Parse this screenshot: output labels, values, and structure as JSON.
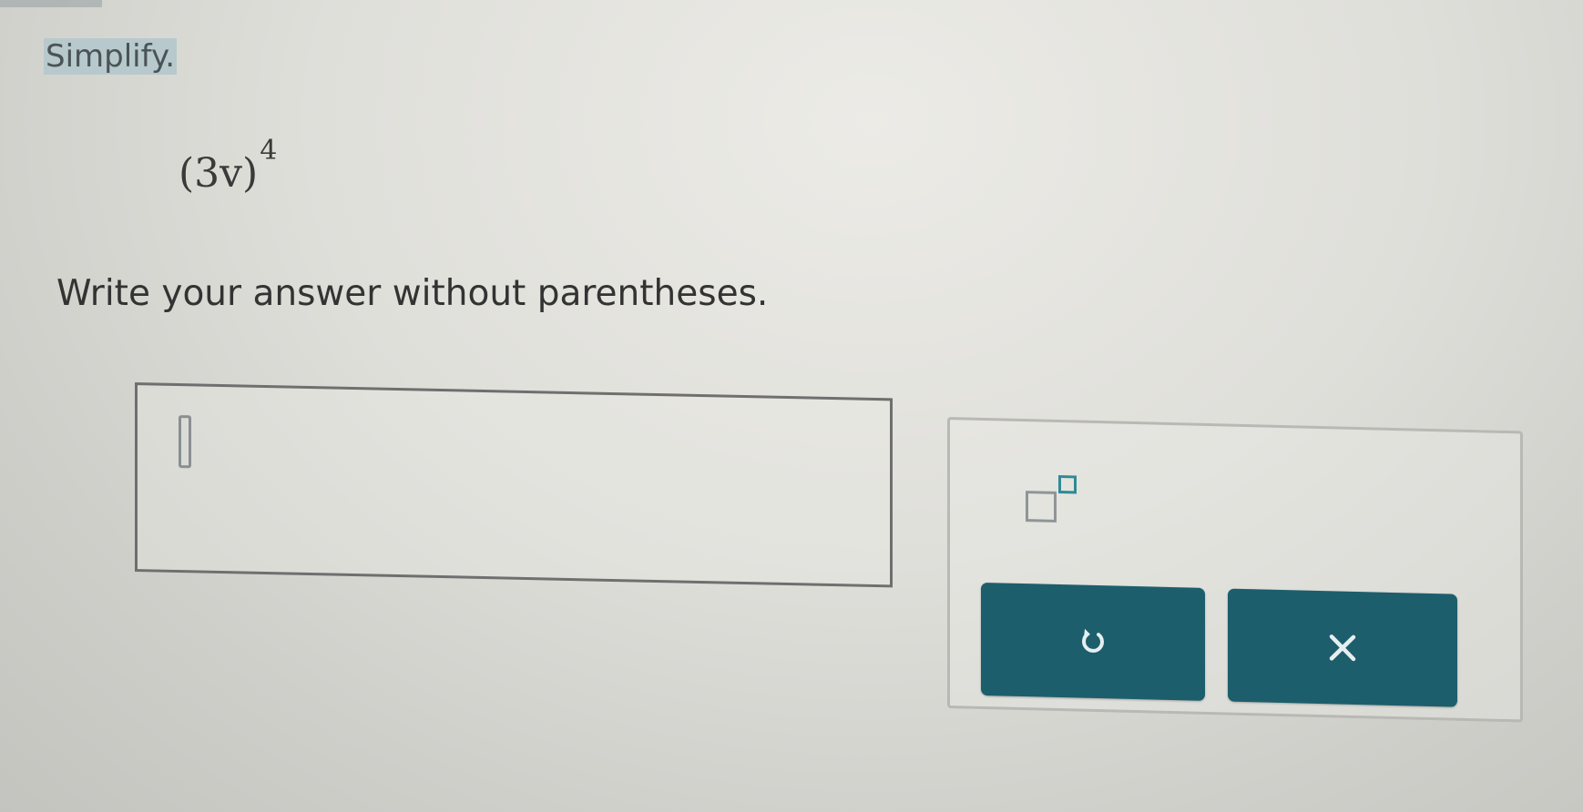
{
  "prompt": {
    "label": "Simplify."
  },
  "problem": {
    "expression": "(3v)",
    "exponent": "4"
  },
  "instruction": {
    "text": "Write your answer without parentheses."
  },
  "answer": {
    "value": ""
  },
  "toolbar": {
    "exponent_icon": "exponent-template-icon",
    "undo_icon": "undo-icon",
    "clear_icon": "close-icon",
    "button_color": "#1d5e6c"
  }
}
